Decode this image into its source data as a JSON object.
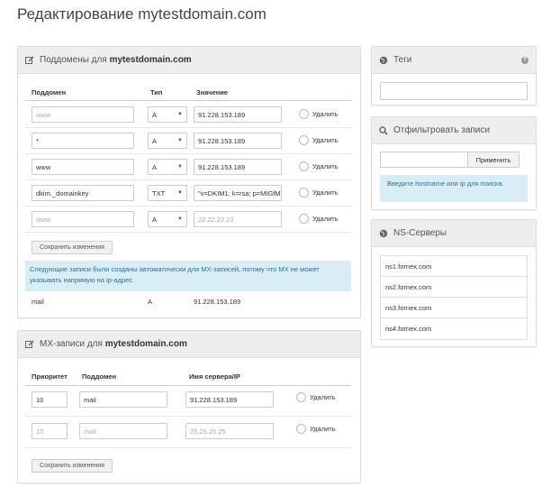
{
  "page": {
    "title": "Редактирование mytestdomain.com"
  },
  "subdomains_panel": {
    "title_prefix": "Поддомены для ",
    "title_domain": "mytestdomain.com",
    "columns": {
      "subdomain": "Поддомен",
      "type": "Тип",
      "value": "Значение"
    },
    "rows": [
      {
        "subdomain": "",
        "subdomain_placeholder": "www",
        "type": "A",
        "value": "91.228.153.189",
        "value_placeholder": "",
        "delete_label": "Удалить"
      },
      {
        "subdomain": "*",
        "subdomain_placeholder": "",
        "type": "A",
        "value": "91.228.153.189",
        "value_placeholder": "",
        "delete_label": "Удалить"
      },
      {
        "subdomain": "www",
        "subdomain_placeholder": "",
        "type": "A",
        "value": "91.228.153.189",
        "value_placeholder": "",
        "delete_label": "Удалить"
      },
      {
        "subdomain": "dkim._domainkey",
        "subdomain_placeholder": "",
        "type": "TXT",
        "value": "\"v=DKIM1; k=rsa; p=MIGfM",
        "value_placeholder": "",
        "delete_label": "Удалить"
      },
      {
        "subdomain": "",
        "subdomain_placeholder": "www",
        "type": "A",
        "value": "",
        "value_placeholder": "22.22.22.22",
        "delete_label": "Удалить"
      }
    ],
    "save_label": "Сохранить изменения",
    "info_text": "Следующие записи были созданы автоматически для MX-записей, потому что MX не может указывать напрямую на ip-адрес",
    "auto_record": {
      "name": "mail",
      "type": "A",
      "value": "91.228.153.189"
    }
  },
  "mx_panel": {
    "title_prefix": "MX-записи для ",
    "title_domain": "mytestdomain.com",
    "columns": {
      "priority": "Приоритет",
      "subdomain": "Поддомен",
      "server": "Имя сервера/IP"
    },
    "rows": [
      {
        "priority": "10",
        "priority_placeholder": "",
        "subdomain": "mail",
        "subdomain_placeholder": "",
        "server": "91.228.153.189",
        "server_placeholder": "",
        "delete_label": "Удалить"
      },
      {
        "priority": "",
        "priority_placeholder": "10",
        "subdomain": "",
        "subdomain_placeholder": "mail",
        "server": "",
        "server_placeholder": "25.25.25.25",
        "delete_label": "Удалить"
      }
    ],
    "save_label": "Сохранить изменения"
  },
  "tags_panel": {
    "title": "Теги",
    "help_icon": "?"
  },
  "filter_panel": {
    "title": "Отфильтровать записи",
    "apply_label": "Применить",
    "hint": "Введите hostname или ip для поиска."
  },
  "ns_panel": {
    "title": "NS-Серверы",
    "servers": [
      "ns1.fornex.com",
      "ns2.fornex.com",
      "ns3.fornex.com",
      "ns4.fornex.com"
    ]
  },
  "icons": {
    "edit": "edit-icon",
    "globe": "globe-icon",
    "search": "search-icon",
    "help": "help-icon"
  }
}
